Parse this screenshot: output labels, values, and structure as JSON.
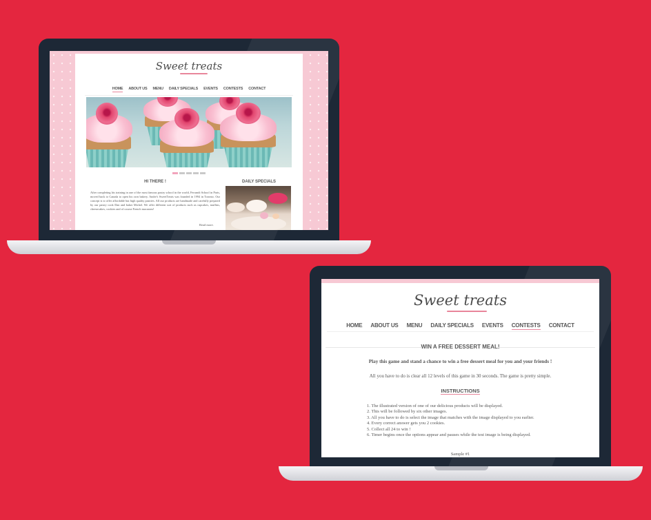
{
  "site1": {
    "logo": "Sweet treats",
    "nav": [
      "HOME",
      "ABOUT US",
      "MENU",
      "DAILY SPECIALS",
      "EVENTS",
      "CONTESTS",
      "CONTACT"
    ],
    "active_nav": "HOME",
    "hi_title": "HI THERE !",
    "specials_title": "DAILY SPECIALS",
    "intro_text": "After completing his training in one of the most famous pastry school in the world, Ferrandi School in Paris, moved back to Canada to open his own bakery. Andre's SweetTreats was founded in 1994 in Toronto. Our concept is to offer affordable but high quality pastries. All our products are handmade and carefully prepared by our pastry cook Dan and baker Michel. We offer different sort of products such as cupcakes, muffins, cheesecakes, cookies and of course French macarons!",
    "read_more": "Read more."
  },
  "site2": {
    "logo": "Sweet treats",
    "nav": [
      "HOME",
      "ABOUT US",
      "MENU",
      "DAILY SPECIALS",
      "EVENTS",
      "CONTESTS",
      "CONTACT"
    ],
    "active_nav": "CONTESTS",
    "contest_title": "WIN A FREE DESSERT MEAL!",
    "play_text": "Play this game and stand a chance to win a free dessert meal for you and your friends !",
    "all_text": "All you have to do is clear all 12 levels of this game in 30 seconds. The game is pretty simple.",
    "instructions_title": "INSTRUCTIONS",
    "instructions": [
      "1. The illustrated version of one of our delicious products will be displayed.",
      "2. This will be followed by six other images.",
      "3. All you have to do is select the image that matches with the image displayed to you earlier.",
      "4. Every correct answer gets you 2 cookies.",
      "5. Collect all 24 to win !",
      "6. Timer begins once the options appear and pauses while the test image is being displayed."
    ],
    "sample_text": "Sample #1"
  },
  "colors": {
    "background": "#e4263f",
    "laptop_bezel": "#1d2836",
    "pink_accent": "#f7c9d4",
    "underline_pink": "#e8859a"
  }
}
